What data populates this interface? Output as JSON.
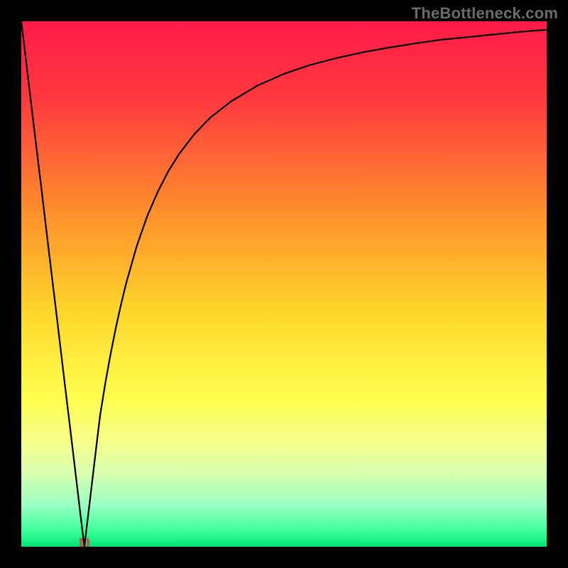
{
  "attribution": "TheBottleneck.com",
  "chart_data": {
    "type": "line",
    "title": "",
    "xlabel": "",
    "ylabel": "",
    "xlim": [
      0,
      100
    ],
    "ylim": [
      0,
      100
    ],
    "background_gradient_stops": [
      {
        "offset": 0,
        "color": "#ff1b48"
      },
      {
        "offset": 15,
        "color": "#ff3a3f"
      },
      {
        "offset": 35,
        "color": "#ff8a2c"
      },
      {
        "offset": 55,
        "color": "#ffd52c"
      },
      {
        "offset": 72,
        "color": "#ffff50"
      },
      {
        "offset": 80,
        "color": "#f6ff8a"
      },
      {
        "offset": 86,
        "color": "#d8ffb0"
      },
      {
        "offset": 92,
        "color": "#9affc4"
      },
      {
        "offset": 97,
        "color": "#3dff9a"
      },
      {
        "offset": 100,
        "color": "#00e673"
      }
    ],
    "series": [
      {
        "name": "bottleneck-curve",
        "stroke": "#000000",
        "stroke_width": 2.25,
        "x": [
          0,
          0.75,
          1.5,
          2.25,
          3,
          3.75,
          4.5,
          5.25,
          6,
          6.75,
          7.5,
          8.25,
          9,
          9.75,
          10.5,
          11.25,
          12,
          12.75,
          13.5,
          14.25,
          15,
          15.5,
          16,
          17,
          18,
          19,
          20,
          22,
          24,
          26,
          28,
          30,
          33,
          36,
          40,
          45,
          50,
          55,
          60,
          65,
          70,
          75,
          80,
          85,
          90,
          95,
          100
        ],
        "y": [
          100,
          93.8,
          87.5,
          81.2,
          75,
          68.8,
          62.5,
          56.2,
          50,
          43.8,
          37.5,
          31.2,
          25,
          18.8,
          12.5,
          6.2,
          0,
          6.2,
          12.5,
          18.8,
          25,
          28.1,
          31.2,
          36.7,
          41.7,
          46.2,
          50.3,
          57.3,
          63,
          67.6,
          71.5,
          74.7,
          78.6,
          81.7,
          84.8,
          87.8,
          90,
          91.7,
          93,
          94.1,
          95,
          95.8,
          96.5,
          97,
          97.5,
          98,
          98.4
        ]
      }
    ],
    "minimum_marker": {
      "glyph": "ᴜ",
      "x": 12,
      "y": 2.2,
      "color": "#b55a4d"
    }
  }
}
